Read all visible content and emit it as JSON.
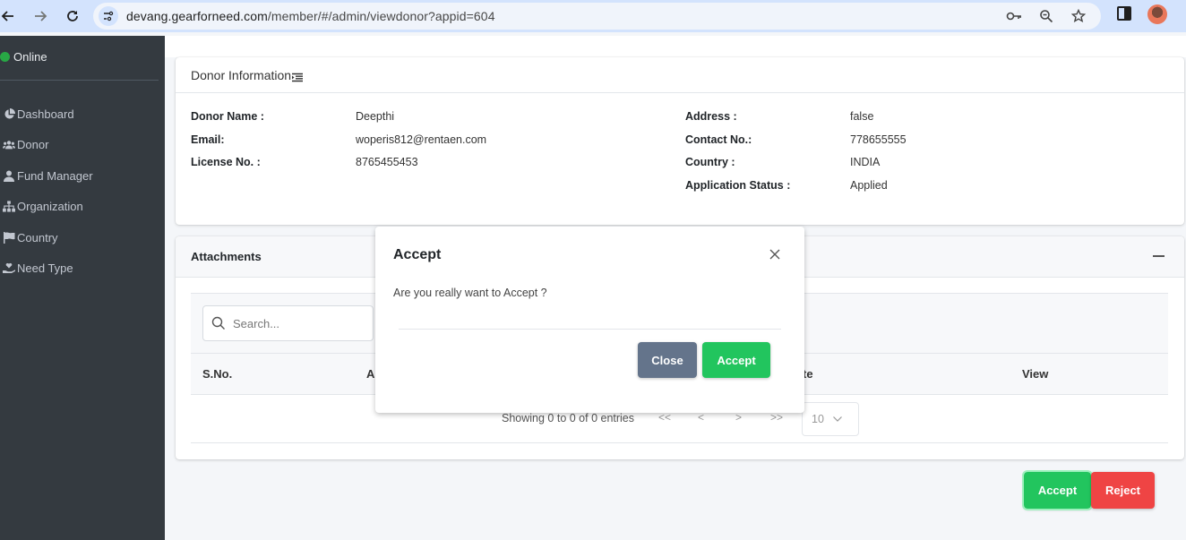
{
  "browser": {
    "url_host": "devang.gearforneed.com",
    "url_path": "/member/#/admin/viewdonor?appid=604",
    "icons": [
      "back-icon",
      "forward-icon",
      "reload-icon",
      "site-settings-icon",
      "password-key-icon",
      "zoom-icon",
      "bookmark-star-icon",
      "side-panel-icon",
      "profile-avatar"
    ]
  },
  "sidebar": {
    "status": "Online",
    "status_color": "#28a745",
    "items": [
      {
        "label": "Dashboard",
        "icon": "chart-pie-icon"
      },
      {
        "label": "Donor",
        "icon": "users-icon"
      },
      {
        "label": "Fund Manager",
        "icon": "user-tie-icon"
      },
      {
        "label": "Organization",
        "icon": "sitemap-icon"
      },
      {
        "label": "Country",
        "icon": "flag-icon"
      },
      {
        "label": "Need Type",
        "icon": "hand-holding-heart-icon"
      }
    ]
  },
  "donor_info": {
    "title": "Donor Information",
    "left": [
      {
        "label": "Donor Name :",
        "value": "Deepthi"
      },
      {
        "label": "Email:",
        "value": "woperis812@rentaen.com"
      },
      {
        "label": "License No. :",
        "value": "8765455453"
      }
    ],
    "right": [
      {
        "label": "Address :",
        "value": "false"
      },
      {
        "label": "Contact No.:",
        "value": "778655555"
      },
      {
        "label": "Country :",
        "value": "INDIA"
      },
      {
        "label": "Application Status :",
        "value": "Applied"
      }
    ]
  },
  "attachments": {
    "title": "Attachments",
    "search_placeholder": "Search...",
    "columns": [
      "S.No.",
      "A",
      "te",
      "View"
    ],
    "rows": [],
    "pagination": {
      "info": "Showing 0 to 0 of 0 entries",
      "first": "<<",
      "prev": "<",
      "next": ">",
      "last": ">>",
      "page_size": "10"
    }
  },
  "actions": {
    "accept": "Accept",
    "reject": "Reject",
    "accept_color": "#22c55e",
    "reject_color": "#ef4444"
  },
  "modal": {
    "title": "Accept",
    "message": "Are you really want to Accept ?",
    "close_label": "Close",
    "accept_label": "Accept"
  }
}
